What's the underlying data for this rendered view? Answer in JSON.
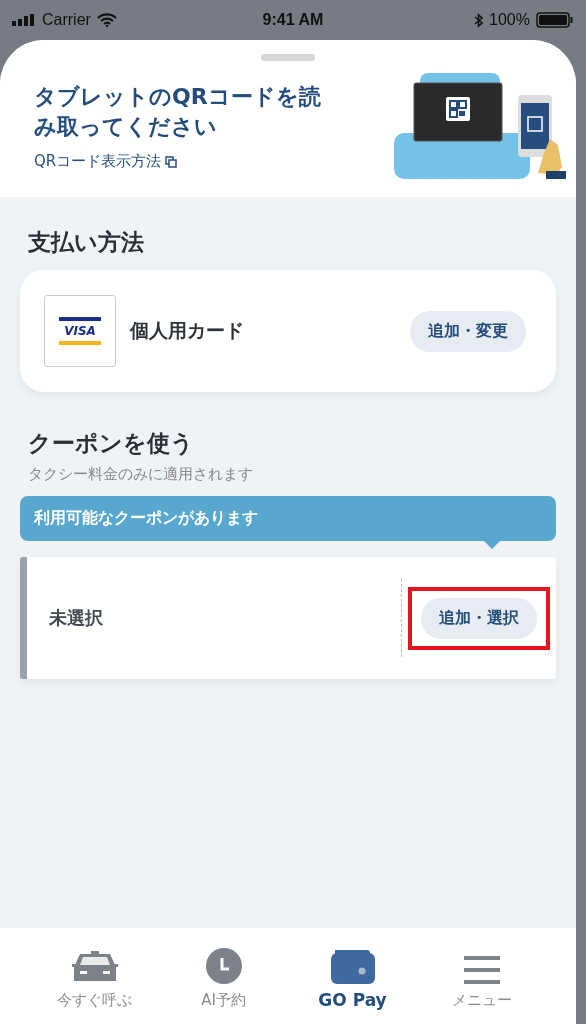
{
  "status_bar": {
    "carrier": "Carrier",
    "time": "9:41 AM",
    "battery": "100%"
  },
  "qr_header": {
    "title": "タブレットのQRコードを読み取ってください",
    "link": "QRコード表示方法"
  },
  "payment": {
    "heading": "支払い方法",
    "card_brand": "VISA",
    "card_name": "個人用カード",
    "button": "追加・変更"
  },
  "coupon": {
    "heading": "クーポンを使う",
    "note": "タクシー料金のみに適用されます",
    "banner": "利用可能なクーポンがあります",
    "value": "未選択",
    "button": "追加・選択",
    "button_highlighted": true
  },
  "tab_bar": [
    {
      "kind": "taxi",
      "label": "今すぐ呼ぶ",
      "selected": false
    },
    {
      "kind": "clock",
      "label": "AI予約",
      "selected": false
    },
    {
      "kind": "wallet",
      "label": "GO Pay",
      "selected": true
    },
    {
      "kind": "menu",
      "label": "メニュー",
      "selected": false
    }
  ]
}
